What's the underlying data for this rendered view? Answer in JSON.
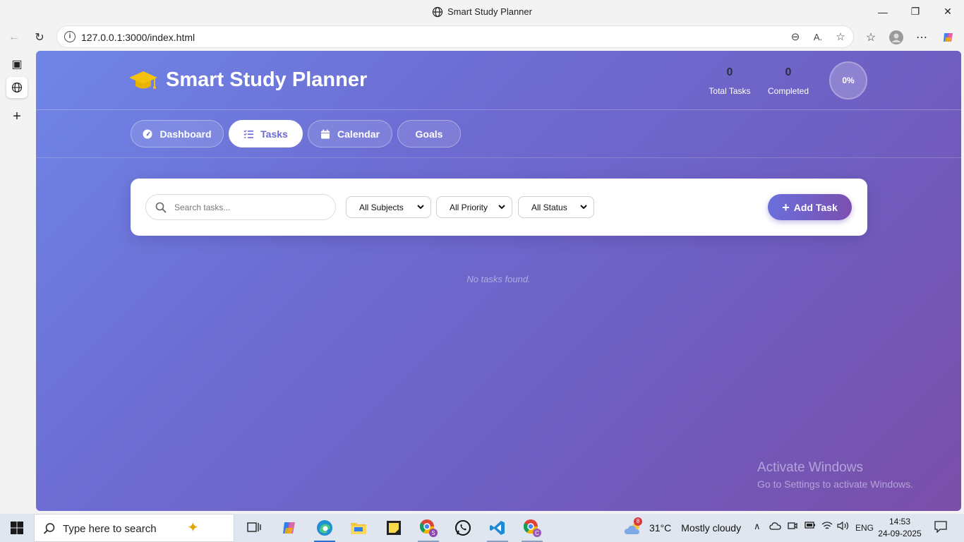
{
  "browser": {
    "window_title": "Smart Study Planner",
    "url": "127.0.0.1:3000/index.html"
  },
  "app": {
    "title": "Smart Study Planner",
    "stats": {
      "total_tasks_value": "0",
      "total_tasks_label": "Total Tasks",
      "completed_value": "0",
      "completed_label": "Completed",
      "progress": "0%"
    },
    "tabs": [
      {
        "label": "Dashboard",
        "icon": "gauge-icon"
      },
      {
        "label": "Tasks",
        "icon": "list-check-icon",
        "active": true
      },
      {
        "label": "Calendar",
        "icon": "calendar-icon"
      },
      {
        "label": "Goals",
        "icon": ""
      }
    ],
    "toolbar": {
      "search_placeholder": "Search tasks...",
      "subject_filter": "All Subjects",
      "priority_filter": "All Priority",
      "status_filter": "All Status",
      "add_button": "Add Task"
    },
    "empty_message": "No tasks found."
  },
  "watermark": {
    "line1": "Activate Windows",
    "line2": "Go to Settings to activate Windows."
  },
  "taskbar": {
    "search_placeholder": "Type here to search",
    "weather_temp": "31°C",
    "weather_text": "Mostly cloudy",
    "weather_badge": "8",
    "language": "ENG",
    "time": "14:53",
    "date": "24-09-2025"
  },
  "colors": {
    "accent": "#6a6ad4",
    "logo_yellow": "#f4c20d"
  }
}
